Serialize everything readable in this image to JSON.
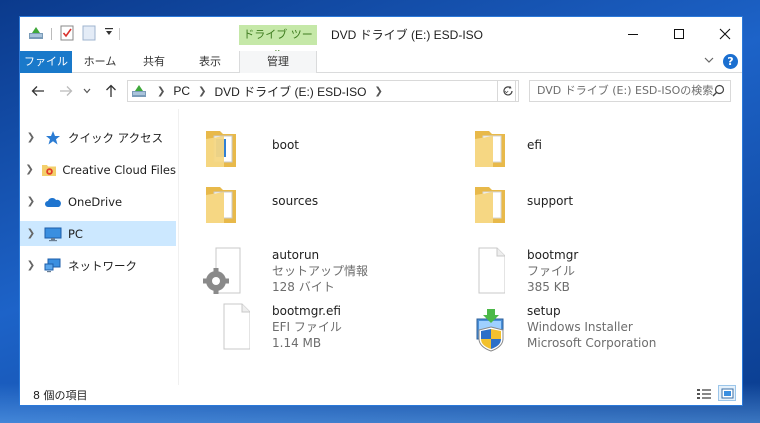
{
  "window": {
    "title": "DVD ドライブ (E:) ESD-ISO",
    "context_tab_group": "ドライブ ツール"
  },
  "ribbon": {
    "tabs": [
      "ファイル",
      "ホーム",
      "共有",
      "表示",
      "管理"
    ],
    "help": "?"
  },
  "address": {
    "parts": [
      "PC",
      "DVD ドライブ (E:) ESD-ISO"
    ]
  },
  "search": {
    "placeholder": "DVD ドライブ (E:) ESD-ISOの検索"
  },
  "nav_pane": {
    "items": [
      {
        "label": "クイック アクセス",
        "icon": "star-icon"
      },
      {
        "label": "Creative Cloud Files",
        "icon": "creative-cloud-folder-icon"
      },
      {
        "label": "OneDrive",
        "icon": "onedrive-cloud-icon"
      },
      {
        "label": "PC",
        "icon": "monitor-icon",
        "selected": true
      },
      {
        "label": "ネットワーク",
        "icon": "network-icon"
      }
    ]
  },
  "files": [
    {
      "name": "boot",
      "type": "folder",
      "icon": "folder-icon"
    },
    {
      "name": "efi",
      "type": "folder",
      "icon": "folder-icon"
    },
    {
      "name": "sources",
      "type": "folder",
      "icon": "folder-icon"
    },
    {
      "name": "support",
      "type": "folder",
      "icon": "folder-icon"
    },
    {
      "name": "autorun",
      "line2": "セットアップ情報",
      "line3": "128 バイト",
      "icon": "settings-file-icon"
    },
    {
      "name": "bootmgr",
      "line2": "ファイル",
      "line3": "385 KB",
      "icon": "blank-file-icon"
    },
    {
      "name": "bootmgr.efi",
      "line2": "EFI ファイル",
      "line3": "1.14 MB",
      "icon": "blank-file-icon"
    },
    {
      "name": "setup",
      "line2": "Windows Installer",
      "line3": "Microsoft Corporation",
      "icon": "installer-shield-icon"
    }
  ],
  "status": {
    "item_count": "8 個の項目"
  },
  "colors": {
    "accent": "#1979ca",
    "selection": "#cce8ff",
    "context_tab": "#c5e8a8",
    "folder": "#f3cf6b"
  }
}
